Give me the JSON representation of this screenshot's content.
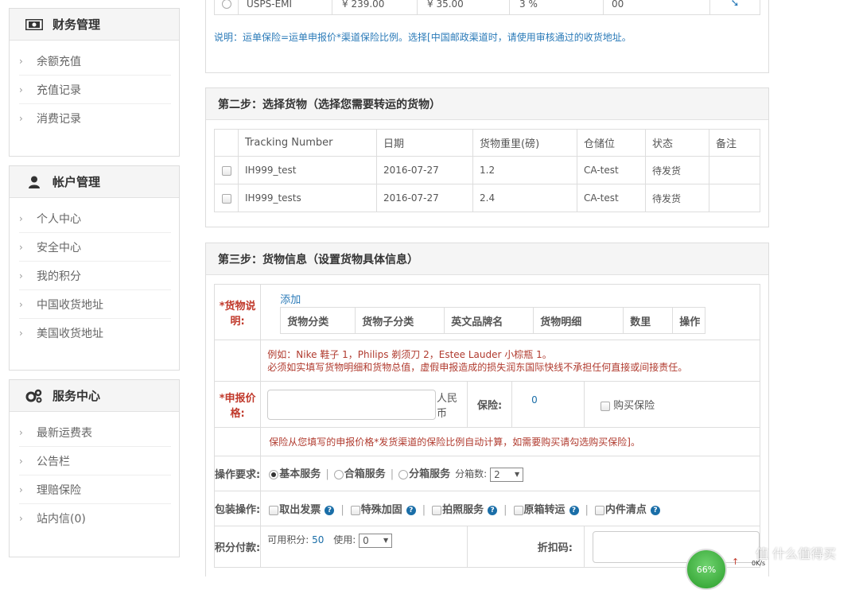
{
  "sidebar": {
    "finance": {
      "title": "财务管理",
      "items": [
        "余额充值",
        "充值记录",
        "消费记录"
      ]
    },
    "account": {
      "title": "帐户管理",
      "items": [
        "个人中心",
        "安全中心",
        "我的积分",
        "中国收货地址",
        "美国收货地址"
      ]
    },
    "service": {
      "title": "服务中心",
      "items": [
        "最新运费表",
        "公告栏",
        "理赔保险",
        "站内信(0)"
      ]
    }
  },
  "step1": {
    "row": {
      "name": "USPS-EMI",
      "price": "¥ 239.00",
      "extra": "¥ 35.00",
      "rate": "3 %",
      "days": "00"
    },
    "note": "说明：运单保险=运单申报价*渠道保险比例。选择[中国邮政渠道时，请使用审核通过的收货地址。"
  },
  "step2": {
    "title": "第二步：选择货物（选择您需要转运的货物）",
    "columns": [
      "Tracking Number",
      "日期",
      "货物重里(磅)",
      "仓储位",
      "状态",
      "备注"
    ],
    "rows": [
      {
        "tracking": "IH999_test",
        "date": "2016-07-27",
        "weight": "1.2",
        "location": "CA-test",
        "status": "待发货",
        "remark": ""
      },
      {
        "tracking": "IH999_tests",
        "date": "2016-07-27",
        "weight": "2.4",
        "location": "CA-test",
        "status": "待发货",
        "remark": ""
      }
    ]
  },
  "step3": {
    "title": "第三步：货物信息（设置货物具体信息）",
    "desc_label": "*货物说明:",
    "add_link": "添加",
    "desc_columns": [
      "货物分类",
      "货物子分类",
      "英文品牌名",
      "货物明细",
      "数里",
      "操作"
    ],
    "example_line1": "例如：Nike 鞋子 1，Philips 剃须刀 2，Estee Lauder 小棕瓶 1。",
    "example_line2": "必须如实填写货物明细和货物总值，虚假申报造成的损失润东国际快线不承担任何直接或间接责任。",
    "price_label": "*申报价格:",
    "price_value": "",
    "currency": "人民币",
    "insurance_label": "保险:",
    "insurance_value": "0",
    "buy_insurance": "购买保险",
    "insurance_note": "保险从您填写的申报价格*发货渠道的保险比例自动计算，如需要购买请勾选购买保险]。",
    "ops_label": "操作要求:",
    "ops_options": [
      "基本服务",
      "合箱服务",
      "分箱服务"
    ],
    "split_label": "分箱数:",
    "split_value": "2",
    "pack_label": "包装操作:",
    "pack_options": [
      "取出发票",
      "特殊加固",
      "拍照服务",
      "原箱转运",
      "内件清点"
    ],
    "points_label": "积分付款:",
    "points_available_label": "可用积分:",
    "points_available": "50",
    "points_use_label": "使用:",
    "points_use_value": "0",
    "discount_label": "折扣码:"
  },
  "overlay": {
    "progress": "66%",
    "speed": "0K/s",
    "watermark": "值 什么值得买"
  },
  "colors": {
    "link": "#2a7ab8",
    "warning": "#b03a2e",
    "blue_value": "#1a6ea8"
  }
}
